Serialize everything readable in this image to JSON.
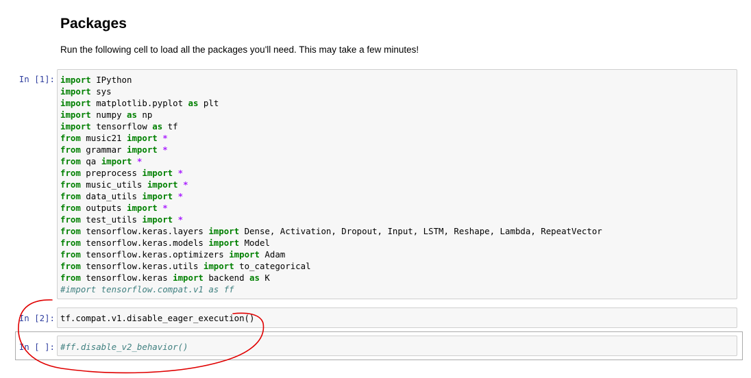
{
  "markdown": {
    "heading": "Packages",
    "text": "Run the following cell to load all the packages you'll need. This may take a few minutes!"
  },
  "cells": [
    {
      "prompt": "In [1]:",
      "lines": [
        [
          {
            "t": "import",
            "c": "kw"
          },
          {
            "t": " IPython"
          }
        ],
        [
          {
            "t": "import",
            "c": "kw"
          },
          {
            "t": " sys"
          }
        ],
        [
          {
            "t": "import",
            "c": "kw"
          },
          {
            "t": " matplotlib.pyplot "
          },
          {
            "t": "as",
            "c": "kw"
          },
          {
            "t": " plt"
          }
        ],
        [
          {
            "t": "import",
            "c": "kw"
          },
          {
            "t": " numpy "
          },
          {
            "t": "as",
            "c": "kw"
          },
          {
            "t": " np"
          }
        ],
        [
          {
            "t": "import",
            "c": "kw"
          },
          {
            "t": " tensorflow "
          },
          {
            "t": "as",
            "c": "kw"
          },
          {
            "t": " tf"
          }
        ],
        [
          {
            "t": "from",
            "c": "kw"
          },
          {
            "t": " music21 "
          },
          {
            "t": "import",
            "c": "kw"
          },
          {
            "t": " "
          },
          {
            "t": "*",
            "c": "star"
          }
        ],
        [
          {
            "t": "from",
            "c": "kw"
          },
          {
            "t": " grammar "
          },
          {
            "t": "import",
            "c": "kw"
          },
          {
            "t": " "
          },
          {
            "t": "*",
            "c": "star"
          }
        ],
        [
          {
            "t": "from",
            "c": "kw"
          },
          {
            "t": " qa "
          },
          {
            "t": "import",
            "c": "kw"
          },
          {
            "t": " "
          },
          {
            "t": "*",
            "c": "star"
          }
        ],
        [
          {
            "t": "from",
            "c": "kw"
          },
          {
            "t": " preprocess "
          },
          {
            "t": "import",
            "c": "kw"
          },
          {
            "t": " "
          },
          {
            "t": "*",
            "c": "star"
          }
        ],
        [
          {
            "t": "from",
            "c": "kw"
          },
          {
            "t": " music_utils "
          },
          {
            "t": "import",
            "c": "kw"
          },
          {
            "t": " "
          },
          {
            "t": "*",
            "c": "star"
          }
        ],
        [
          {
            "t": "from",
            "c": "kw"
          },
          {
            "t": " data_utils "
          },
          {
            "t": "import",
            "c": "kw"
          },
          {
            "t": " "
          },
          {
            "t": "*",
            "c": "star"
          }
        ],
        [
          {
            "t": "from",
            "c": "kw"
          },
          {
            "t": " outputs "
          },
          {
            "t": "import",
            "c": "kw"
          },
          {
            "t": " "
          },
          {
            "t": "*",
            "c": "star"
          }
        ],
        [
          {
            "t": "from",
            "c": "kw"
          },
          {
            "t": " test_utils "
          },
          {
            "t": "import",
            "c": "kw"
          },
          {
            "t": " "
          },
          {
            "t": "*",
            "c": "star"
          }
        ],
        [
          {
            "t": "from",
            "c": "kw"
          },
          {
            "t": " tensorflow.keras.layers "
          },
          {
            "t": "import",
            "c": "kw"
          },
          {
            "t": " Dense, Activation, Dropout, Input, LSTM, Reshape, Lambda, RepeatVector"
          }
        ],
        [
          {
            "t": "from",
            "c": "kw"
          },
          {
            "t": " tensorflow.keras.models "
          },
          {
            "t": "import",
            "c": "kw"
          },
          {
            "t": " Model"
          }
        ],
        [
          {
            "t": "from",
            "c": "kw"
          },
          {
            "t": " tensorflow.keras.optimizers "
          },
          {
            "t": "import",
            "c": "kw"
          },
          {
            "t": " Adam"
          }
        ],
        [
          {
            "t": "from",
            "c": "kw"
          },
          {
            "t": " tensorflow.keras.utils "
          },
          {
            "t": "import",
            "c": "kw"
          },
          {
            "t": " to_categorical"
          }
        ],
        [
          {
            "t": "from",
            "c": "kw"
          },
          {
            "t": " tensorflow.keras "
          },
          {
            "t": "import",
            "c": "kw"
          },
          {
            "t": " backend "
          },
          {
            "t": "as",
            "c": "kw"
          },
          {
            "t": " K"
          }
        ],
        [
          {
            "t": "#import tensorflow.compat.v1 as ff",
            "c": "cm"
          }
        ]
      ]
    },
    {
      "prompt": "In [2]:",
      "lines": [
        [
          {
            "t": "tf.compat.v1.disable_eager_execution()"
          }
        ]
      ]
    },
    {
      "prompt": "In [ ]:",
      "lines": [
        [
          {
            "t": "#ff.disable_v2_behavior()",
            "c": "cm"
          }
        ]
      ]
    }
  ],
  "colors": {
    "keyword": "#008000",
    "star": "#aa22ff",
    "comment": "#408080",
    "prompt": "#303f9f",
    "annotation": "#e00000"
  }
}
